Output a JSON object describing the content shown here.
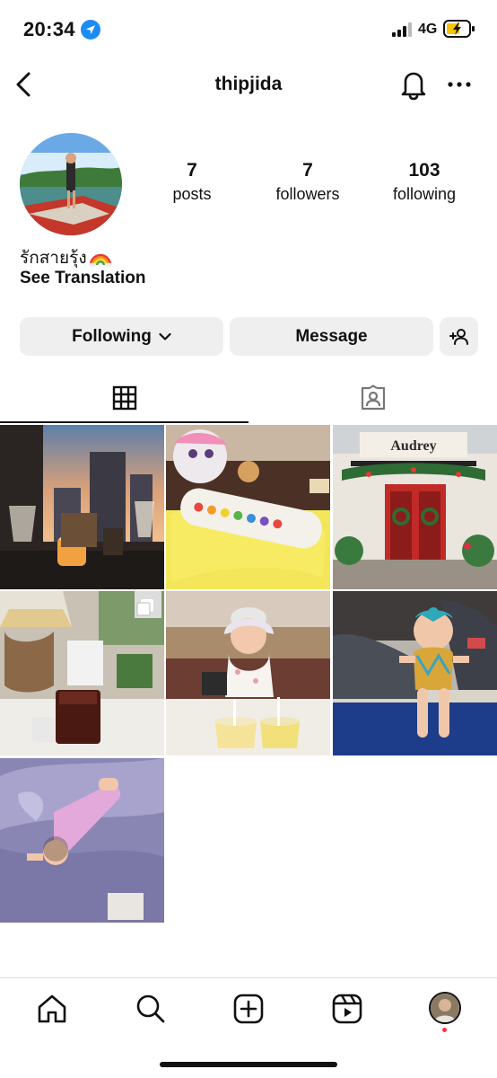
{
  "status_bar": {
    "time": "20:34",
    "network": "4G",
    "icons": [
      "location-arrow-icon",
      "signal-bars-icon",
      "battery-charging-icon"
    ]
  },
  "nav": {
    "username": "thipjida",
    "icons": [
      "back-chevron-icon",
      "bell-icon",
      "more-horizontal-icon"
    ]
  },
  "profile": {
    "stats": [
      {
        "value": "7",
        "label": "posts"
      },
      {
        "value": "7",
        "label": "followers"
      },
      {
        "value": "103",
        "label": "following"
      }
    ],
    "bio_name": "รักสายรุ้ง",
    "bio_emoji": "rainbow",
    "see_translation": "See Translation"
  },
  "actions": {
    "following_label": "Following",
    "message_label": "Message",
    "add_user_icon": "add-user-icon"
  },
  "tabs": {
    "items": [
      "grid-icon",
      "tagged-person-icon"
    ],
    "active": 0
  },
  "posts": [
    {
      "description_icon": "city-sunset-drinks"
    },
    {
      "description_icon": "toy-and-candy-pen"
    },
    {
      "description_icon": "storefront-with-wreaths"
    },
    {
      "description_icon": "cafe-iced-tea",
      "multi": true
    },
    {
      "description_icon": "baby-with-juices"
    },
    {
      "description_icon": "baby-in-swimsuit"
    },
    {
      "description_icon": "baby-sleeping-blanket"
    }
  ],
  "shop_sign_text": "Audrey",
  "bottom_nav": {
    "items": [
      "home-icon",
      "search-icon",
      "create-icon",
      "reels-icon",
      "profile-avatar"
    ]
  },
  "colors": {
    "accent_blue": "#1c8cf5",
    "button_gray": "#efefef",
    "notification_red": "#ff3040"
  }
}
